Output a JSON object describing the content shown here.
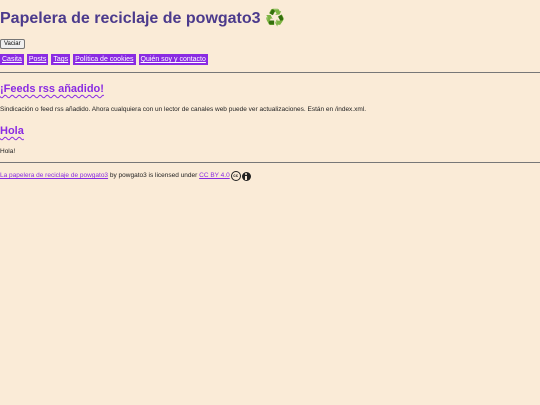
{
  "header": {
    "title": "Papelera de reciclaje de powgato3",
    "title_icon": "♻️",
    "empty_button_label": "Vaciar"
  },
  "nav": {
    "items": [
      {
        "label": "Casita"
      },
      {
        "label": "Posts"
      },
      {
        "label": "Tags"
      },
      {
        "label": "Política de cookies"
      },
      {
        "label": "Quién soy y contacto"
      }
    ]
  },
  "posts": [
    {
      "title": "¡Feeds rss añadido!",
      "body": "Sindicación o feed rss añadido. Ahora cualquiera con un lector de canales web puede ver actualizaciones. Están en /index.xml."
    },
    {
      "title": "Hola",
      "body": "Hola!"
    }
  ],
  "footer": {
    "site_link": "La papelera de reciclaje de powgato3",
    "text_by": " by powgato3 is licensed under ",
    "license_link": "CC BY 4.0",
    "cc_icon_text": "cc"
  },
  "colors": {
    "background": "#faebd7",
    "accent": "#8a2be2",
    "title": "#4b3a8c"
  }
}
